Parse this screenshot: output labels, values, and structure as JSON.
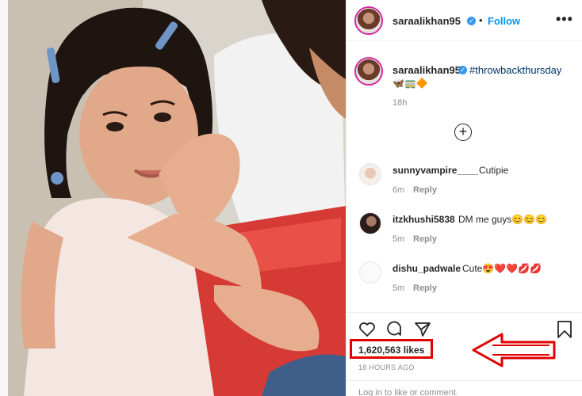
{
  "post": {
    "username": "saraalikhan95",
    "verified_mark": "✓",
    "separator": "•",
    "follow_label": "Follow",
    "more_label": "•••"
  },
  "caption": {
    "username": "saraalikhan95",
    "hashtag": "#throwbackthursday",
    "emojis": "🦋🚃🔶",
    "time": "18h"
  },
  "load_more_label": "+",
  "comments": [
    {
      "username": "sunnyvampire____",
      "text": "Cutipie",
      "time": "6m",
      "reply": "Reply"
    },
    {
      "username": "itzkhushi5838",
      "text": "DM me guys😊😊😊",
      "time": "5m",
      "reply": "Reply"
    },
    {
      "username": "dishu_padwale",
      "text": "Cute😍❤️❤️💋💋",
      "time": "5m",
      "reply": "Reply"
    }
  ],
  "actions": {
    "like_icon": "heart-icon",
    "comment_icon": "comment-icon",
    "share_icon": "share-icon",
    "save_icon": "bookmark-icon"
  },
  "likes": "1,620,563 likes",
  "posted_time": "18 HOURS AGO",
  "login_hint": "Log in to like or comment.",
  "colors": {
    "follow": "#0095f6",
    "hashtag": "#00376b",
    "highlight": "#e00000",
    "muted": "#8e8e8e"
  }
}
